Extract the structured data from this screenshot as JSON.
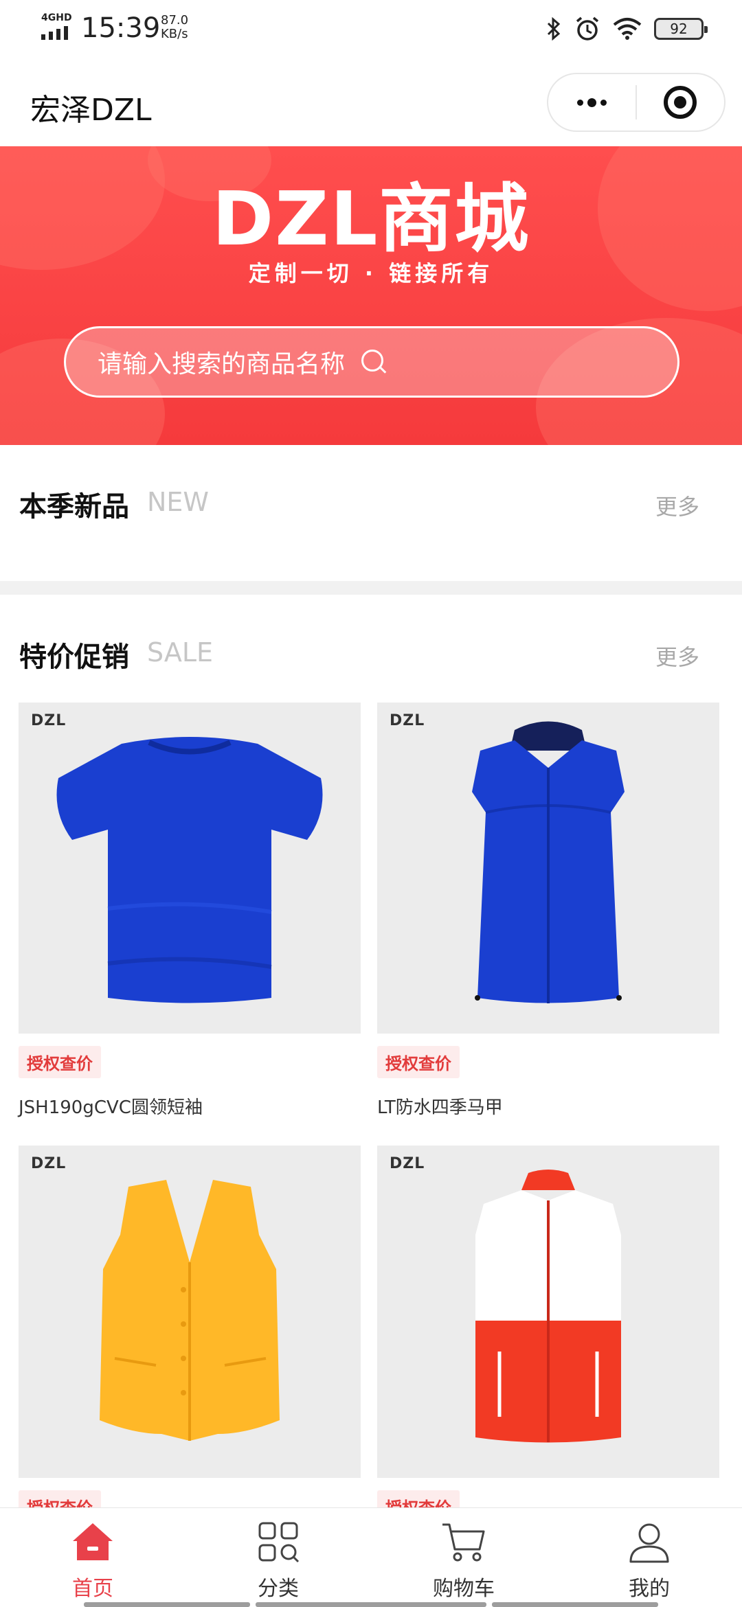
{
  "status_bar": {
    "network": "4GHD",
    "time": "15:39",
    "speed_value": "87.0",
    "speed_unit": "KB/s",
    "battery": "92",
    "icons": [
      "bluetooth-icon",
      "alarm-icon",
      "wifi-icon",
      "battery-icon"
    ]
  },
  "nav": {
    "title": "宏泽DZL",
    "more_icon": "more-dots-icon",
    "close_icon": "target-circle-icon"
  },
  "banner": {
    "logo": "DZL商城",
    "slogan": "定制一切 · 链接所有",
    "search_placeholder": "请输入搜索的商品名称",
    "accent": "#f7403f"
  },
  "sections": {
    "new": {
      "title": "本季新品",
      "subtitle": "NEW",
      "more": "更多"
    },
    "sale": {
      "title": "特价促销",
      "subtitle": "SALE",
      "more": "更多"
    }
  },
  "products": [
    {
      "brand": "DZL",
      "tag": "授权查价",
      "name": "JSH190gCVC圆领短袖",
      "image": "blue-tshirt"
    },
    {
      "brand": "DZL",
      "tag": "授权查价",
      "name": "LT防水四季马甲",
      "image": "blue-hooded-vest"
    },
    {
      "brand": "DZL",
      "tag": "授权查价",
      "name": "",
      "image": "yellow-vest"
    },
    {
      "brand": "DZL",
      "tag": "授权查价",
      "name": "",
      "image": "red-white-vest"
    }
  ],
  "tabs": [
    {
      "label": "首页",
      "icon": "home-icon",
      "active": true
    },
    {
      "label": "分类",
      "icon": "category-grid-icon",
      "active": false
    },
    {
      "label": "购物车",
      "icon": "cart-icon",
      "active": false
    },
    {
      "label": "我的",
      "icon": "user-icon",
      "active": false
    }
  ],
  "colors": {
    "accent": "#e8414a",
    "tag_bg": "#fdecec",
    "tag_text": "#e23b3b",
    "blue_garment": "#1a3fd0",
    "yellow_garment": "#ffb828",
    "red_garment": "#f23a24"
  }
}
